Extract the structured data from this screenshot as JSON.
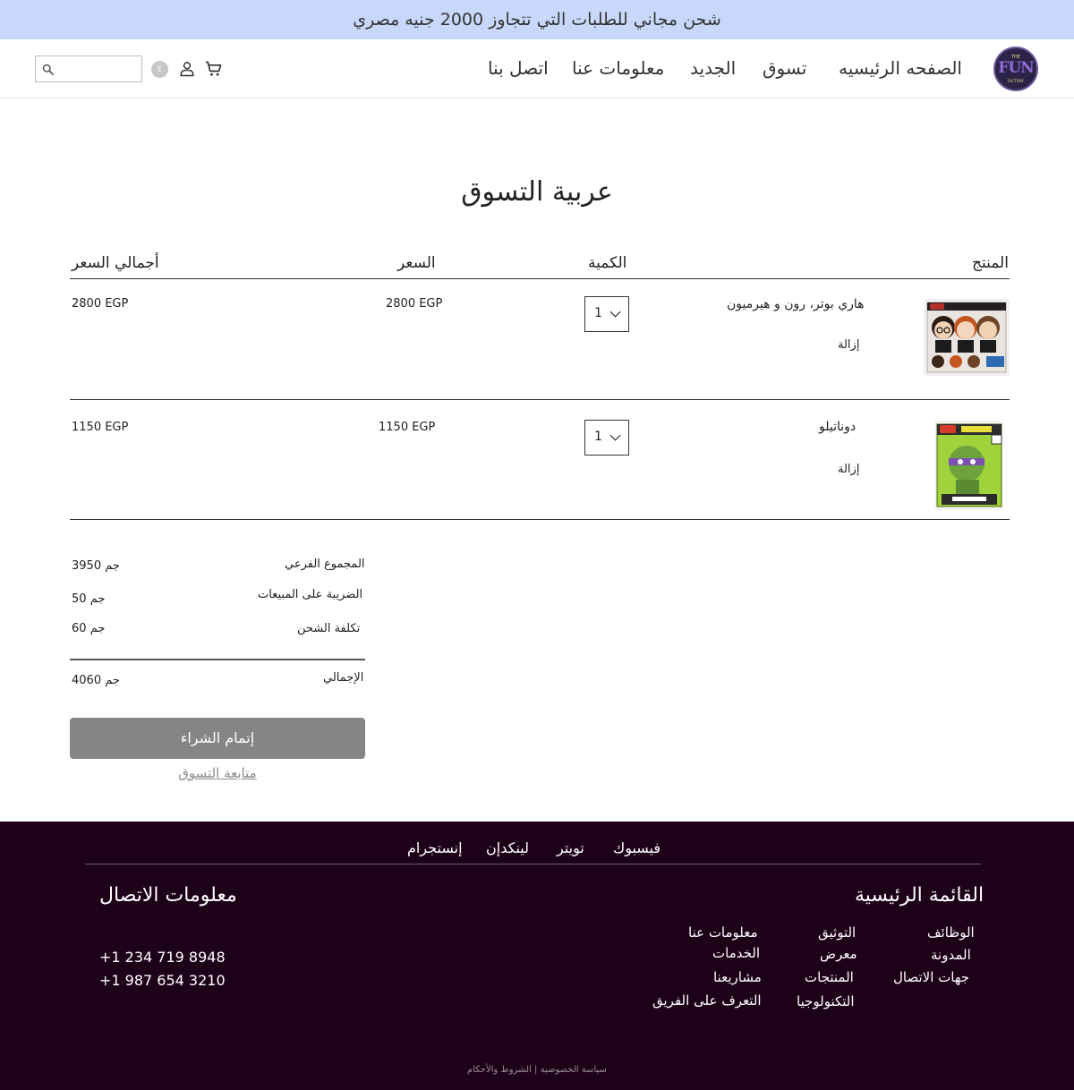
{
  "banner": {
    "text": "شحن مجاني للطلبات التي تتجاوز 2000 جنيه مصري"
  },
  "header": {
    "logo": {
      "top": "THE",
      "main": "FUN",
      "bottom": "FACTORY"
    },
    "nav": {
      "home": "الصفحه الرئيسيه",
      "shop": "تسوق",
      "new": "الجديد",
      "about": "معلومات عنا",
      "contact": "اتصل بنا"
    },
    "language_badge": "E",
    "search_placeholder": ""
  },
  "cart": {
    "title": "عربية التسوق",
    "columns": {
      "product": "المنتج",
      "quantity": "الكمية",
      "price": "السعر",
      "total": "أجمالي السعر"
    },
    "items": [
      {
        "name": "هاري بوتر، رون و هيرميون",
        "remove": "إزالة",
        "quantity": "1",
        "price": "2800 EGP",
        "total": "2800 EGP",
        "image": "harry-potter-funko-3pack"
      },
      {
        "name": "دوناتيلو",
        "remove": "إزالة",
        "quantity": "1",
        "price": "1150 EGP",
        "total": "1150  EGP",
        "image": "donatello-funko-pop"
      }
    ]
  },
  "summary": {
    "subtotal_label": "المجموع الفرعي",
    "subtotal_value": "3950 جم",
    "tax_label": "الضريبة على المبيعات",
    "tax_value": "50 جم",
    "shipping_label": "تكلفة الشحن",
    "shipping_value": "60 جم",
    "total_label": "الإجمالي",
    "total_value": "4060 جم",
    "checkout_label": "إتمام الشراء",
    "continue_label": "متابعة التسوق "
  },
  "footer": {
    "social": {
      "facebook": "فيسبوك",
      "twitter": "تويتر",
      "linkedin": "لينكدإن",
      "instagram": "إنستجرام"
    },
    "main_menu_title": "القائمة الرئيسية",
    "menu_col1": [
      "الوظائف",
      "المدونة",
      "جهات الاتصال"
    ],
    "menu_col2": [
      "التوثيق",
      "معرض",
      "المنتجات",
      "التكنولوجيا"
    ],
    "menu_col3": [
      "معلومات عنا",
      "الخدمات",
      "مشاريعنا",
      "التعرف على الفريق"
    ],
    "contact_title": "معلومات الاتصال",
    "phones": [
      "+1 234 719 8948",
      "+1 987 654 3210"
    ],
    "legal": {
      "privacy": "سياسة الخصوصية",
      "separator": "|",
      "terms": "الشروط والأحكام"
    }
  },
  "colors": {
    "banner_bg": "#c8d8fa",
    "footer_bg": "#1c0119",
    "checkout_bg": "#858585",
    "logo_bg": "#2b2447",
    "logo_accent": "#8c6bd6"
  },
  "icons": [
    "cart-icon",
    "user-icon",
    "search-icon",
    "chevron-down-icon",
    "logo"
  ]
}
